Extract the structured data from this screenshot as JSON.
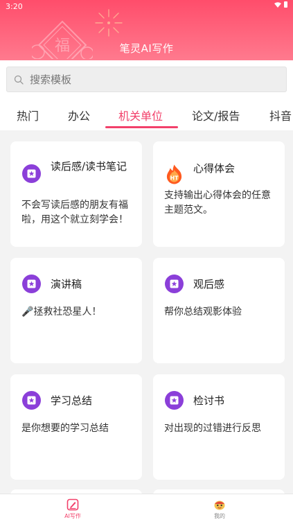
{
  "status_bar": {
    "time": "3:20"
  },
  "header": {
    "title": "笔灵AI写作",
    "decoration_text": "福"
  },
  "search": {
    "placeholder": "搜索模板"
  },
  "tabs": [
    {
      "label": "热门"
    },
    {
      "label": "办公"
    },
    {
      "label": "机关单位",
      "active": true
    },
    {
      "label": "论文/报告"
    },
    {
      "label": "抖音"
    }
  ],
  "cards": [
    {
      "icon": "star-badge-icon",
      "title": "读后感/读书笔记",
      "desc": "不会写读后感的朋友有福啦，用这个就立刻学会！"
    },
    {
      "icon": "ht-flame-icon",
      "icon_text": "HT",
      "title": "心得体会",
      "desc": "支持输出心得体会的任意主题范文。"
    },
    {
      "icon": "star-badge-icon",
      "title": "演讲稿",
      "desc": "🎤拯救社恐星人！"
    },
    {
      "icon": "star-badge-icon",
      "title": "观后感",
      "desc": "帮你总结观影体验"
    },
    {
      "icon": "star-badge-icon",
      "title": "学习总结",
      "desc": "是你想要的学习总结"
    },
    {
      "icon": "star-badge-icon",
      "title": "检讨书",
      "desc": "对出现的过错进行反思"
    }
  ],
  "bottom_nav": [
    {
      "label": "AI写作",
      "icon": "pen-icon",
      "active": true
    },
    {
      "label": "我的",
      "icon": "mascot-icon"
    }
  ],
  "colors": {
    "accent": "#f2406a",
    "header_start": "#ff4d6b",
    "header_end": "#ff7a8e",
    "badge": "#8b3fd9",
    "background": "#f3f3f3"
  }
}
